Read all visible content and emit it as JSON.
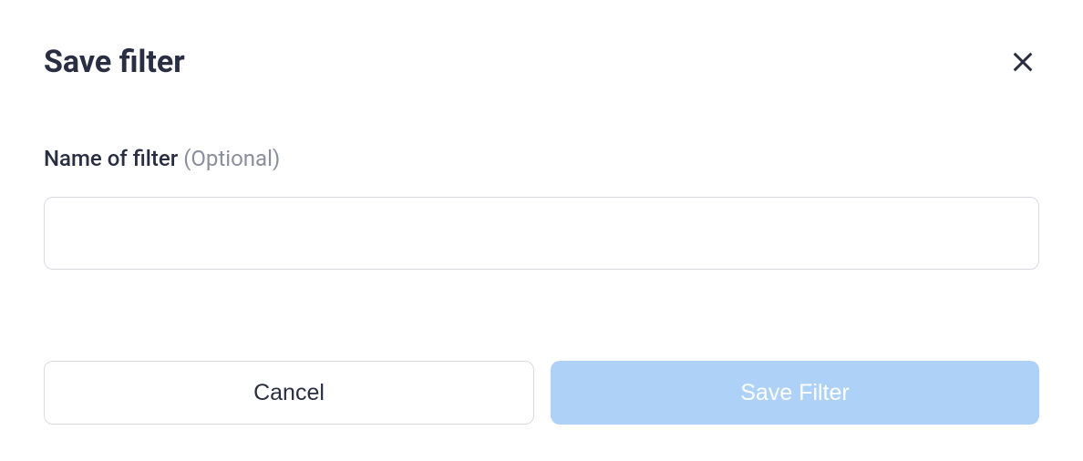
{
  "modal": {
    "title": "Save filter",
    "field": {
      "label": "Name of filter",
      "optional": "(Optional)",
      "value": ""
    },
    "buttons": {
      "cancel": "Cancel",
      "save": "Save Filter"
    }
  }
}
